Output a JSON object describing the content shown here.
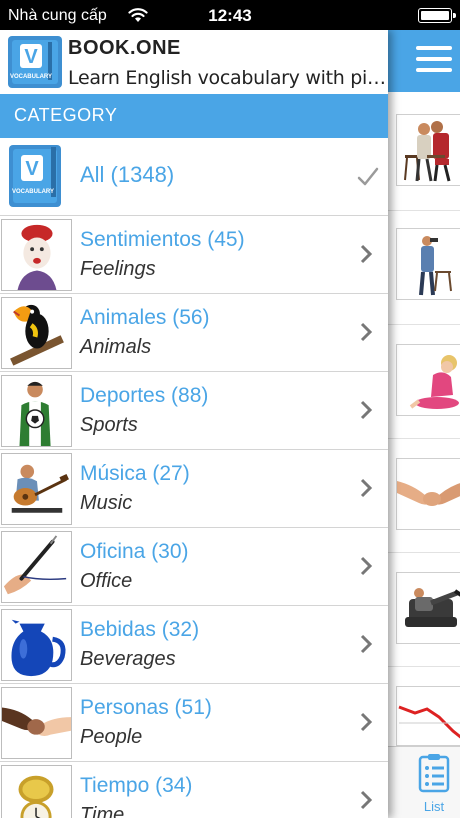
{
  "status_bar": {
    "carrier": "Nhà cung cấp",
    "time": "12:43",
    "wifi_icon": "wifi-icon",
    "battery_icon": "battery-icon"
  },
  "app": {
    "name": "BOOK.ONE",
    "tagline": "Learn English vocabulary with pic...",
    "logo_text": "V",
    "logo_caption": "VOCABULARY"
  },
  "category_header": "CATEGORY",
  "all_row": {
    "label": "All (1348)",
    "selected_icon": "checkmark-icon"
  },
  "categories": [
    {
      "title": "Sentimientos (45)",
      "subtitle": "Feelings"
    },
    {
      "title": "Animales (56)",
      "subtitle": "Animals"
    },
    {
      "title": "Deportes (88)",
      "subtitle": "Sports"
    },
    {
      "title": "Música (27)",
      "subtitle": "Music"
    },
    {
      "title": "Oficina (30)",
      "subtitle": "Office"
    },
    {
      "title": "Bebidas (32)",
      "subtitle": "Beverages"
    },
    {
      "title": "Personas (51)",
      "subtitle": "People"
    },
    {
      "title": "Tiempo (34)",
      "subtitle": "Time"
    }
  ],
  "tabbar": {
    "list_label": "List"
  },
  "colors": {
    "accent": "#4aa5e6",
    "header_bar": "#4aa5e6",
    "status_bar": "#000000"
  }
}
